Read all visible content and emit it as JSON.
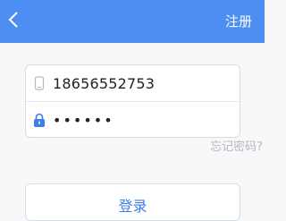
{
  "header": {
    "register_label": "注册",
    "back_icon": "chevron-left-icon",
    "bg_color": "#4c8ef2"
  },
  "form": {
    "phone": {
      "value": "18656552753",
      "icon": "phone-icon"
    },
    "password": {
      "value": "••••••",
      "icon": "lock-icon",
      "icon_color": "#3d7ee8"
    },
    "forgot_label": "忘记密码?"
  },
  "actions": {
    "login_label": "登录",
    "login_color": "#3d7ee8"
  }
}
